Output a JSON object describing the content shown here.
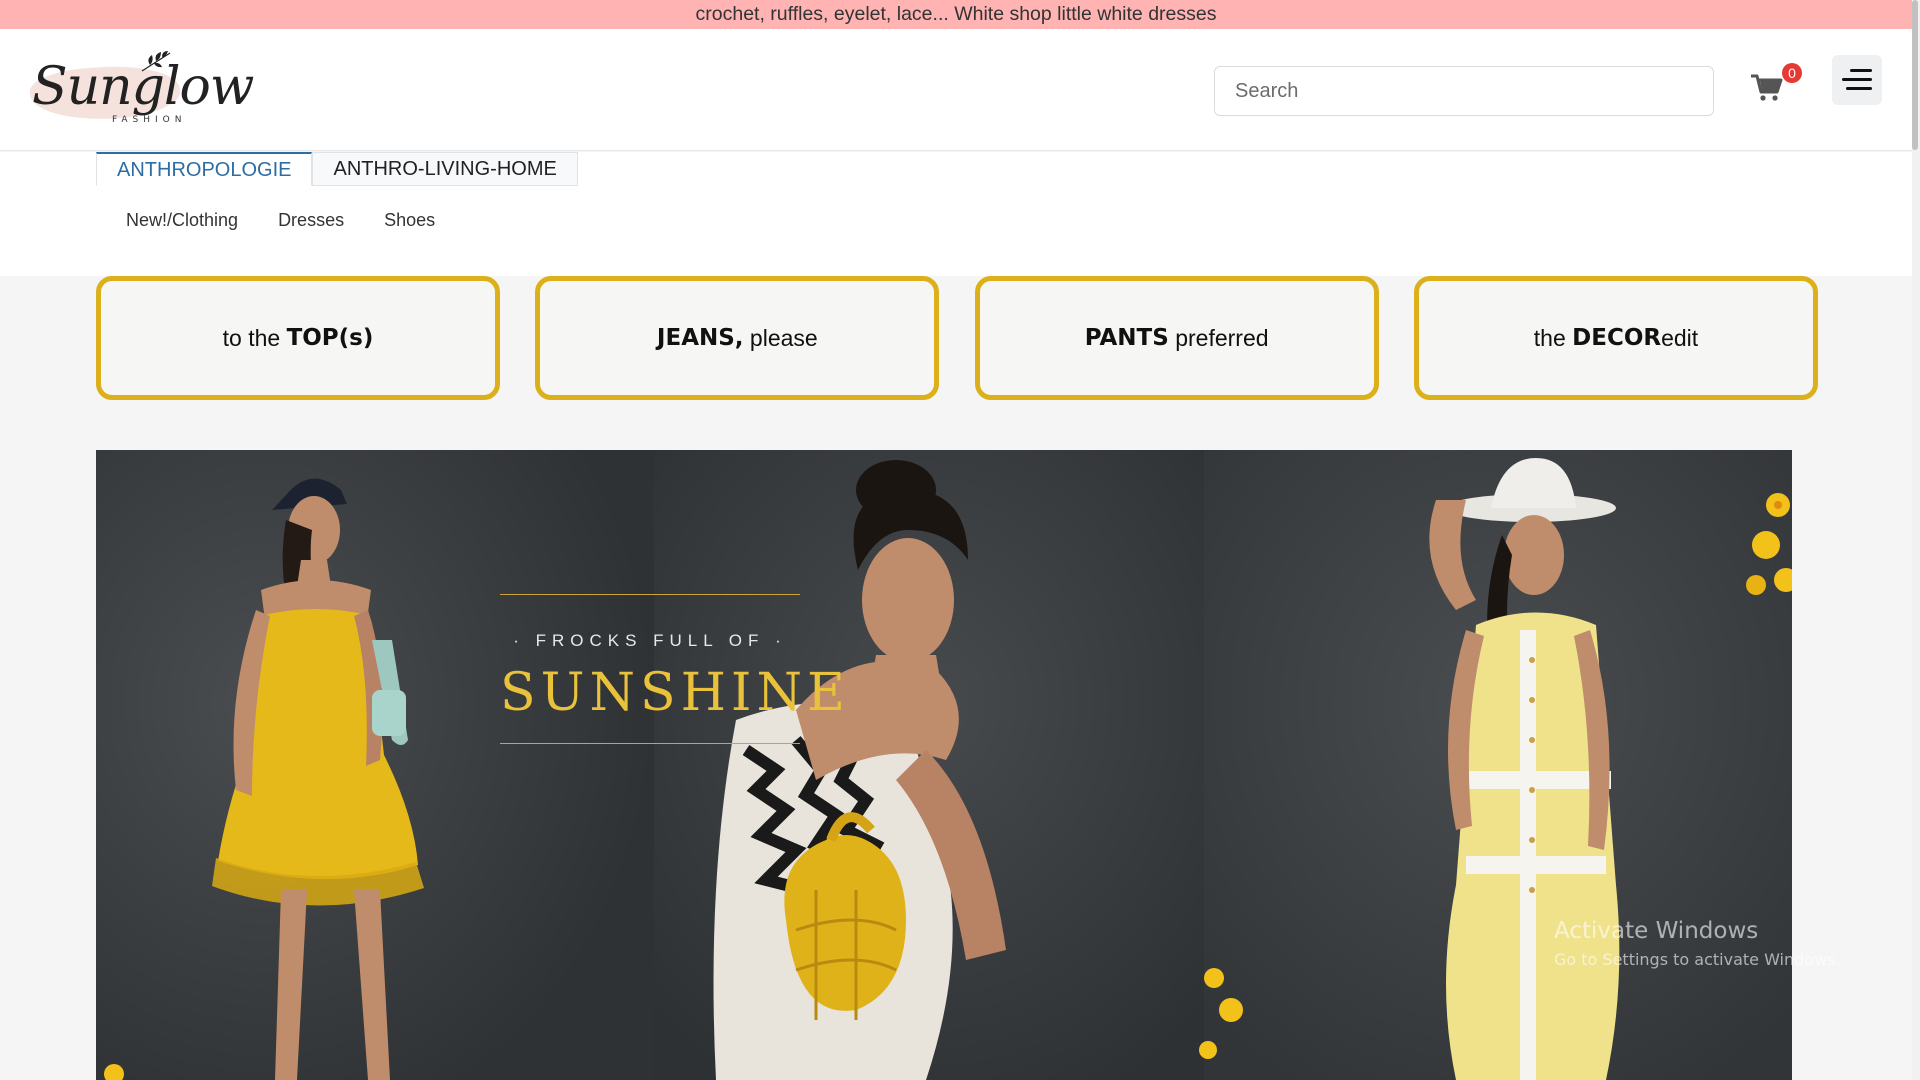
{
  "promo": {
    "text": "crochet, ruffles, eyelet, lace... White shop little white dresses"
  },
  "brand": {
    "name": "Sunglow",
    "sub": "FASHION"
  },
  "search": {
    "placeholder": "Search"
  },
  "cart": {
    "count": "0",
    "icon": "cart-icon"
  },
  "menu": {
    "icon": "hamburger-menu-icon"
  },
  "tabs": [
    {
      "label": "ANTHROPOLOGIE",
      "active": true
    },
    {
      "label": "ANTHRO-LIVING-HOME",
      "active": false
    }
  ],
  "subnav": [
    "New!/Clothing",
    "Dresses",
    "Shoes"
  ],
  "categories": [
    {
      "pre": "to the ",
      "bold": "TOP(s)",
      "post": ""
    },
    {
      "pre": "",
      "bold": "JEANS,",
      "post": " please"
    },
    {
      "pre": "",
      "bold": "PANTS",
      "post": " preferred"
    },
    {
      "pre": "the ",
      "bold": "DECOR",
      "post": "edit"
    }
  ],
  "hero": {
    "kicker": "· FROCKS FULL OF ·",
    "title": "SUNSHINE"
  },
  "colors": {
    "promo": "#ffb3b3",
    "accent_gold": "#dcb01a",
    "tab_active": "#2e6da4",
    "badge": "#e53935"
  },
  "windows": {
    "line1": "Activate Windows",
    "line2": "Go to Settings to activate Windows."
  }
}
